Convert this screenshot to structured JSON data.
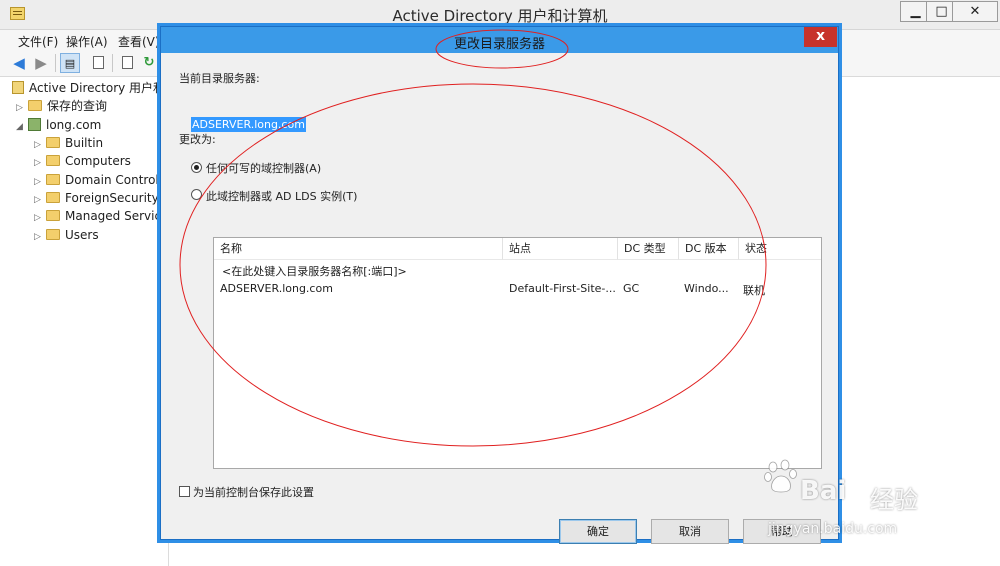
{
  "main_window": {
    "title": "Active Directory 用户和计算机",
    "controls": {
      "minimize": "▁",
      "maximize": "□",
      "close": "✕"
    },
    "menu": [
      "文件(F)",
      "操作(A)",
      "查看(V)"
    ]
  },
  "tree": {
    "root": "Active Directory 用户和计",
    "saved_queries": "保存的查询",
    "domain": "long.com",
    "children": [
      "Builtin",
      "Computers",
      "Domain Controlle",
      "ForeignSecurityPr",
      "Managed Service",
      "Users"
    ]
  },
  "dialog": {
    "title": "更改目录服务器",
    "close": "x",
    "current_label": "当前目录服务器:",
    "current_server": "ADSERVER.long.com",
    "change_to_label": "更改为:",
    "option_any": "任何可写的域控制器(A)",
    "option_this": "此域控制器或 AD LDS 实例(T)",
    "option_any_selected": true,
    "columns": [
      "名称",
      "站点",
      "DC 类型",
      "DC 版本",
      "状态"
    ],
    "placeholder_row": "<在此处键入目录服务器名称[:端口]>",
    "rows": [
      {
        "name": "ADSERVER.long.com",
        "site": "Default-First-Site-...",
        "dc_type": "GC",
        "dc_version": "Windo...",
        "status": "联机"
      }
    ],
    "save_setting_label": "为当前控制台保存此设置",
    "save_setting_checked": false,
    "ok": "确定",
    "cancel": "取消",
    "help": "帮助"
  },
  "watermark": {
    "brand_left": "Bai",
    "brand_right": "经验",
    "url": "jingyan.baidu.com"
  },
  "colors": {
    "accent": "#3a9ae8",
    "close_red": "#c7332b",
    "selection": "#3399ff",
    "annotation": "#e02020"
  }
}
